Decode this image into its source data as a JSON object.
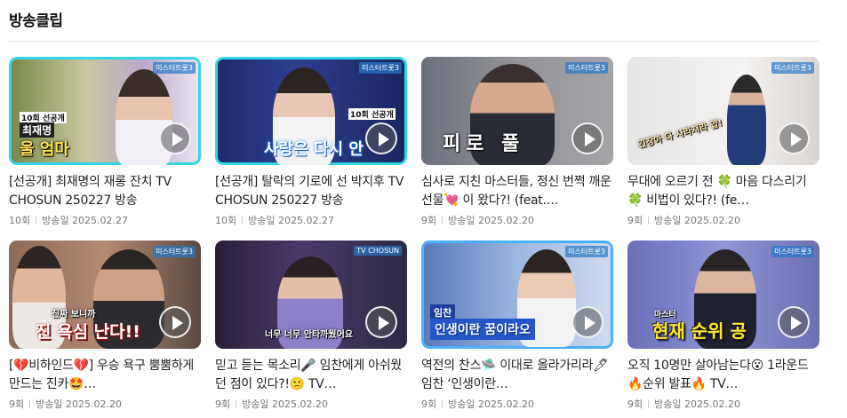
{
  "section": {
    "title": "방송클립"
  },
  "clips": [
    {
      "title": "[선공개] 최재명의 재롱 잔치 TV CHOSUN 250227 방송",
      "episode": "10회",
      "aired": "방송일 2025.02.27",
      "caption": "울 엄마",
      "badge": "10회 선공개",
      "name_tag": "최재명",
      "logo": "미스터트롯3"
    },
    {
      "title": "[선공개] 탈락의 기로에 선 박지후 TV CHOSUN 250227 방송",
      "episode": "10회",
      "aired": "방송일 2025.02.27",
      "caption": "사랑은 다시 안",
      "badge": "10회 선공개",
      "logo": "미스터트롯3"
    },
    {
      "title": "심사로 지친 마스터들, 정신 번쩍 깨운 선물💘 이 왔다?! (feat.…",
      "episode": "9회",
      "aired": "방송일 2025.02.20",
      "caption": "피로  풀",
      "logo": "미스터트롯3"
    },
    {
      "title": "무대에 오르기 전 🍀 마음 다스리기🍀 비법이 있다?! (fe…",
      "episode": "9회",
      "aired": "방송일 2025.02.20",
      "caption": "긴장아 다 사라져라 얍!",
      "logo": "미스터트롯3"
    },
    {
      "title": "[💔비하인드💔] 우승 욕구 뿜뿜하게 만드는 진카🤩…",
      "episode": "9회",
      "aired": "방송일 2025.02.20",
      "caption": "진 욕심 난다!!",
      "sub_caption": "진짜 보니까",
      "logo": "미스터트롯3"
    },
    {
      "title": "믿고 듣는 목소리🎤 임찬에게 아쉬웠던 점이 있다?!🙁 TV…",
      "episode": "9회",
      "aired": "방송일 2025.02.20",
      "caption": "너무 너무 안타까웠어요",
      "logo": "TV CHOSUN"
    },
    {
      "title": "역전의 찬스🛸 이대로 올라가리라🖊 임찬 ‘인생이란…",
      "episode": "9회",
      "aired": "방송일 2025.02.20",
      "caption": "인생이란 꿈이라오",
      "name_tag": "임찬",
      "logo": "미스터트롯3"
    },
    {
      "title": "오직 10명만 살아남는다😮 1라운드 🔥순위 발표🔥 TV…",
      "episode": "9회",
      "aired": "방송일 2025.02.20",
      "caption": "현재 순위 공",
      "badge": "마스터",
      "logo": "미스터트롯3"
    }
  ]
}
